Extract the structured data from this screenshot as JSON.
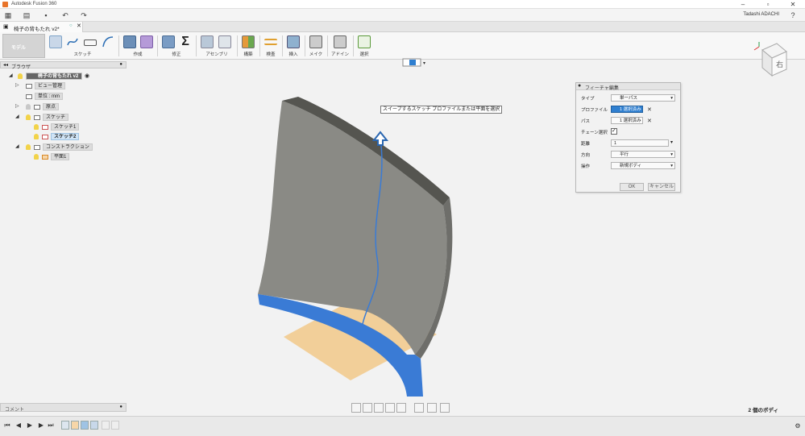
{
  "window": {
    "title": "Autodesk Fusion 360",
    "user": "Tadashi ADACHI"
  },
  "document_tab": {
    "name": "椅子の背もたれ v2*"
  },
  "toolbar": {
    "workspace": "モデル",
    "groups": [
      "スケッチ",
      "作成",
      "修正",
      "アセンブリ",
      "構築",
      "検査",
      "挿入",
      "メイク",
      "アドイン",
      "選択"
    ]
  },
  "browser": {
    "title": "ブラウザ",
    "root": "椅子の背もたれ v2",
    "items": [
      "ビュー管理",
      "単位 : mm",
      "原点",
      "スケッチ",
      "スケッチ1",
      "スケッチ2",
      "コンストラクション",
      "平面1"
    ]
  },
  "comment": {
    "title": "コメント"
  },
  "tooltip": {
    "text": "スイープするスケッチ プロファイルまたは平面を選択"
  },
  "dialog": {
    "title": "フィーチャ編集",
    "rows": [
      {
        "label": "タイプ",
        "value": "単一パス"
      },
      {
        "label": "プロファイル",
        "value": "1 選択済み"
      },
      {
        "label": "パス",
        "value": "1 選択済み"
      },
      {
        "label": "チェーン選択",
        "value": ""
      },
      {
        "label": "距離",
        "value": "1"
      },
      {
        "label": "方向",
        "value": "平行"
      },
      {
        "label": "操作",
        "value": "新規ボディ"
      }
    ],
    "ok": "OK",
    "cancel": "キャンセル"
  },
  "viewcube": {
    "label": "右"
  },
  "status": {
    "bodies": "2 個のボディ"
  },
  "colors": {
    "accent": "#2f7fd0",
    "surface": "#8a8a85",
    "plane": "#f2c98a",
    "path": "#3a7bd5"
  },
  "icons": {
    "app": "grid-icon",
    "file": "file-icon",
    "save": "save-icon",
    "undo": "undo-icon",
    "redo": "redo-icon",
    "settings": "gear-icon"
  }
}
